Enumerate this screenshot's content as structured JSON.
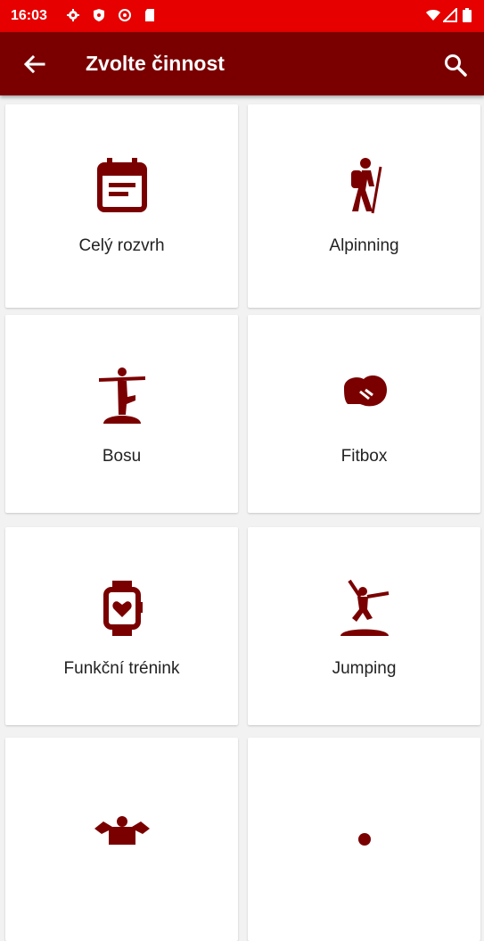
{
  "status_bar": {
    "time": "16:03",
    "background": "#e60000",
    "left_icons": [
      "gear-icon",
      "shield-icon",
      "data-saver-icon",
      "sd-card-icon"
    ],
    "right_icons": [
      "wifi-icon",
      "signal-icon",
      "battery-icon"
    ]
  },
  "app_bar": {
    "title": "Zvolte činnost",
    "background": "#7a0000",
    "back_icon": "arrow-back-icon",
    "search_icon": "search-icon"
  },
  "activities": [
    {
      "label": "Celý rozvrh",
      "icon": "calendar-icon"
    },
    {
      "label": "Alpinning",
      "icon": "hiker-icon"
    },
    {
      "label": "Bosu",
      "icon": "bosu-balance-icon"
    },
    {
      "label": "Fitbox",
      "icon": "boxing-glove-icon"
    },
    {
      "label": "Funkční trénink",
      "icon": "smartwatch-heart-icon"
    },
    {
      "label": "Jumping",
      "icon": "trampoline-jump-icon"
    },
    {
      "label": "",
      "icon": "strongman-icon"
    },
    {
      "label": "",
      "icon": "person-icon"
    }
  ],
  "accent_color": "#7a0000"
}
